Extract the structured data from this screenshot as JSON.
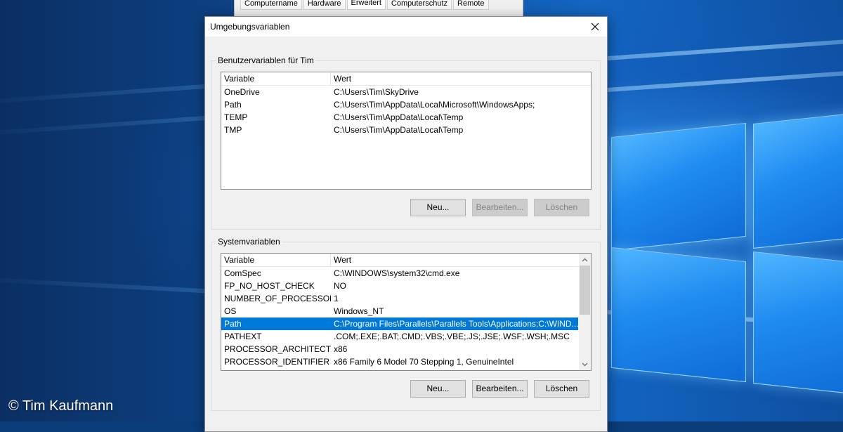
{
  "background_tabs": [
    "Computername",
    "Hardware",
    "Erweitert",
    "Computerschutz",
    "Remote"
  ],
  "dialog": {
    "title": "Umgebungsvariablen",
    "user_group_label": "Benutzervariablen für Tim",
    "system_group_label": "Systemvariablen",
    "columns": {
      "variable": "Variable",
      "value": "Wert"
    },
    "user_vars": [
      {
        "name": "OneDrive",
        "value": "C:\\Users\\Tim\\SkyDrive"
      },
      {
        "name": "Path",
        "value": "C:\\Users\\Tim\\AppData\\Local\\Microsoft\\WindowsApps;"
      },
      {
        "name": "TEMP",
        "value": "C:\\Users\\Tim\\AppData\\Local\\Temp"
      },
      {
        "name": "TMP",
        "value": "C:\\Users\\Tim\\AppData\\Local\\Temp"
      }
    ],
    "system_vars": [
      {
        "name": "ComSpec",
        "value": "C:\\WINDOWS\\system32\\cmd.exe"
      },
      {
        "name": "FP_NO_HOST_CHECK",
        "value": "NO"
      },
      {
        "name": "NUMBER_OF_PROCESSORS",
        "value": "1"
      },
      {
        "name": "OS",
        "value": "Windows_NT"
      },
      {
        "name": "Path",
        "value": "C:\\Program Files\\Parallels\\Parallels Tools\\Applications;C:\\WIND..."
      },
      {
        "name": "PATHEXT",
        "value": ".COM;.EXE;.BAT;.CMD;.VBS;.VBE;.JS;.JSE;.WSF;.WSH;.MSC"
      },
      {
        "name": "PROCESSOR_ARCHITECTURE",
        "value": "x86"
      },
      {
        "name": "PROCESSOR_IDENTIFIER",
        "value": "x86 Family 6 Model 70 Stepping 1, GenuineIntel"
      }
    ],
    "selected_system_var": "Path",
    "buttons": {
      "new": "Neu...",
      "edit": "Bearbeiten...",
      "delete": "Löschen"
    }
  },
  "copyright": "© Tim Kaufmann",
  "colors": {
    "selection": "#0078d7",
    "dialog_bg": "#f0f0f0"
  }
}
